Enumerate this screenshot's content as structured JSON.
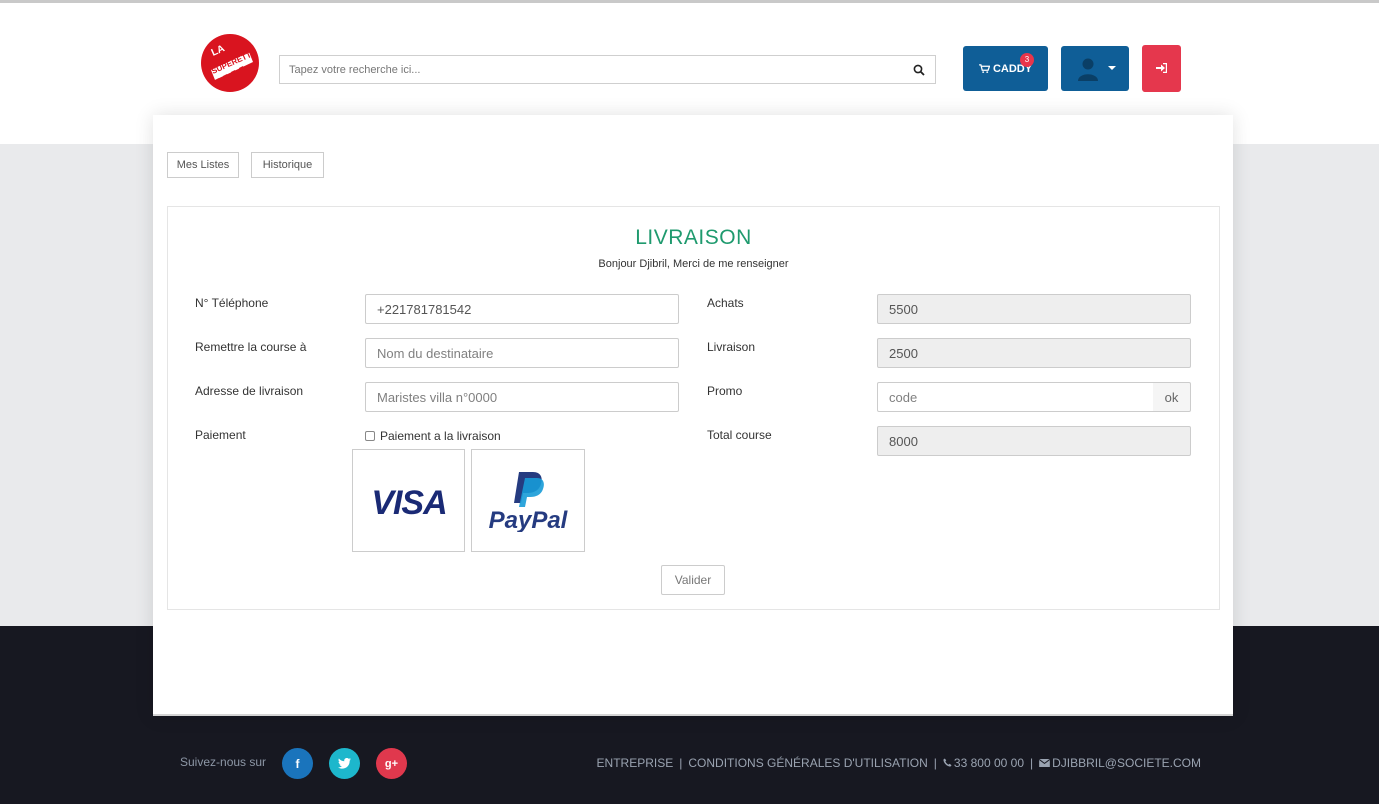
{
  "header": {
    "logo_text": "LA SUPERETTE",
    "search_placeholder": "Tapez votre recherche ici...",
    "caddy_label": "CADDY",
    "caddy_count": "3",
    "accent_blue": "#0f5e97",
    "accent_red": "#e5374d"
  },
  "tabs": [
    {
      "label": "Mes Listes"
    },
    {
      "label": "Historique"
    }
  ],
  "form": {
    "title": "LIVRAISON",
    "subtitle": "Bonjour Djibril, Merci de me renseigner",
    "title_color": "#1f9a6e",
    "left": {
      "phone_label": "N° Téléphone",
      "phone_value": "+221781781542",
      "recipient_label": "Remettre la course à",
      "recipient_placeholder": "Nom du destinataire",
      "address_label": "Adresse de livraison",
      "address_placeholder": "Maristes villa n°0000",
      "payment_label": "Paiement",
      "cash_on_delivery_label": "Paiement a la livraison",
      "payment_methods": [
        "VISA",
        "PayPal"
      ]
    },
    "right": {
      "achats_label": "Achats",
      "achats_value": "5500",
      "livraison_label": "Livraison",
      "livraison_value": "2500",
      "promo_label": "Promo",
      "promo_placeholder": "code",
      "promo_button": "ok",
      "total_label": "Total course",
      "total_value": "8000"
    },
    "submit_label": "Valider"
  },
  "footer": {
    "follow_label": "Suivez-nous sur",
    "socials": [
      {
        "name": "facebook",
        "glyph": "f"
      },
      {
        "name": "twitter",
        "glyph": "t"
      },
      {
        "name": "google-plus",
        "glyph": "g+"
      }
    ],
    "link_company": "ENTREPRISE",
    "link_terms": "CONDITIONS GÉNÉRALES D'UTILISATION",
    "phone": "33 800 00 00",
    "email": "DJIBBRIL@SOCIETE.COM"
  }
}
